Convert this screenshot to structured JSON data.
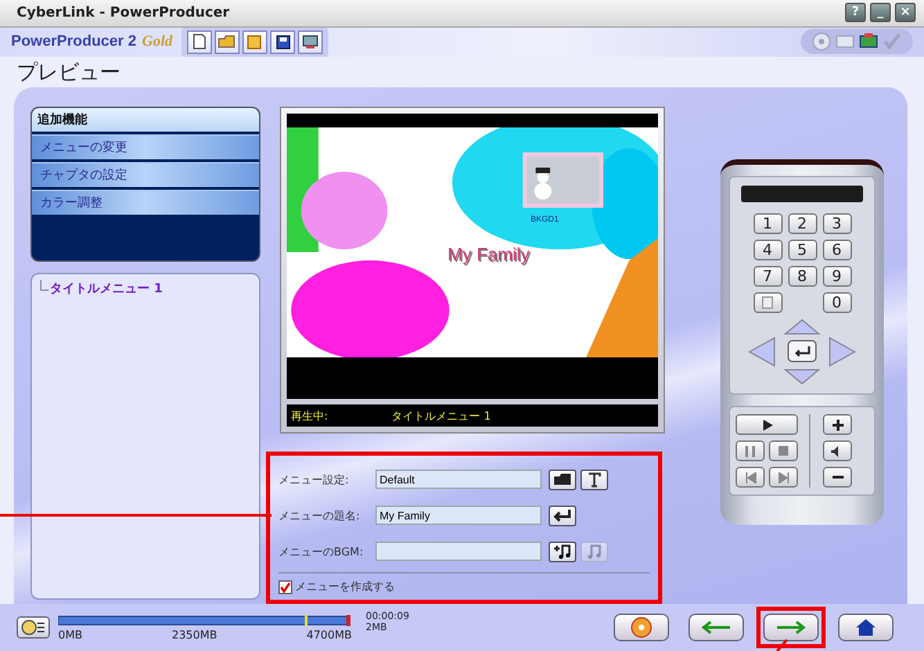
{
  "window": {
    "title": "CyberLink - PowerProducer",
    "controls": [
      "?",
      "_",
      "×"
    ]
  },
  "toolbar": {
    "logo": {
      "brand": "PowerProducer",
      "version": "2",
      "edition": "Gold"
    },
    "tools": [
      {
        "kind": "new"
      },
      {
        "kind": "open"
      },
      {
        "kind": "save"
      },
      {
        "kind": "save-as"
      },
      {
        "kind": "print"
      }
    ],
    "steps": [
      {
        "kind": "disc",
        "active": false
      },
      {
        "kind": "film",
        "active": false
      },
      {
        "kind": "film-edit",
        "active": true
      },
      {
        "kind": "check",
        "active": false
      }
    ]
  },
  "heading": "プレビュー",
  "functions": {
    "header": "追加機能",
    "items": [
      "メニューの変更",
      "チャプタの設定",
      "カラー調整"
    ]
  },
  "tree": {
    "items": [
      {
        "label": "タイトルメニュー 1"
      }
    ]
  },
  "preview": {
    "title_text": "My Family",
    "thumbnail_caption": "BKGD1",
    "status_label": "再生中:",
    "status_value": "タイトルメニュー 1"
  },
  "settings": {
    "highlighted": true,
    "rows": [
      {
        "label": "メニュー設定:",
        "value": "Default",
        "buttons": [
          {
            "kind": "folder",
            "disabled": false
          },
          {
            "kind": "text",
            "disabled": false
          }
        ]
      },
      {
        "label": "メニューの題名:",
        "value": "My Family",
        "buttons": [
          {
            "kind": "enter",
            "disabled": false
          }
        ]
      },
      {
        "label": "メニューのBGM:",
        "buttons": [
          {
            "kind": "add-music",
            "disabled": false
          },
          {
            "kind": "music",
            "disabled": true
          }
        ]
      }
    ],
    "checkbox": {
      "label": "メニューを作成する",
      "checked": true
    }
  },
  "remote": {
    "keys": [
      "1",
      "2",
      "3",
      "4",
      "5",
      "6",
      "7",
      "8",
      "9",
      "0"
    ]
  },
  "capacity": {
    "labels": [
      "0MB",
      "2350MB",
      "4700MB"
    ],
    "time": "00:00:09",
    "size": "2MB"
  },
  "nav": [
    {
      "kind": "burn",
      "highlighted": false
    },
    {
      "kind": "back",
      "highlighted": false
    },
    {
      "kind": "next",
      "highlighted": true
    },
    {
      "kind": "home",
      "highlighted": false
    }
  ]
}
